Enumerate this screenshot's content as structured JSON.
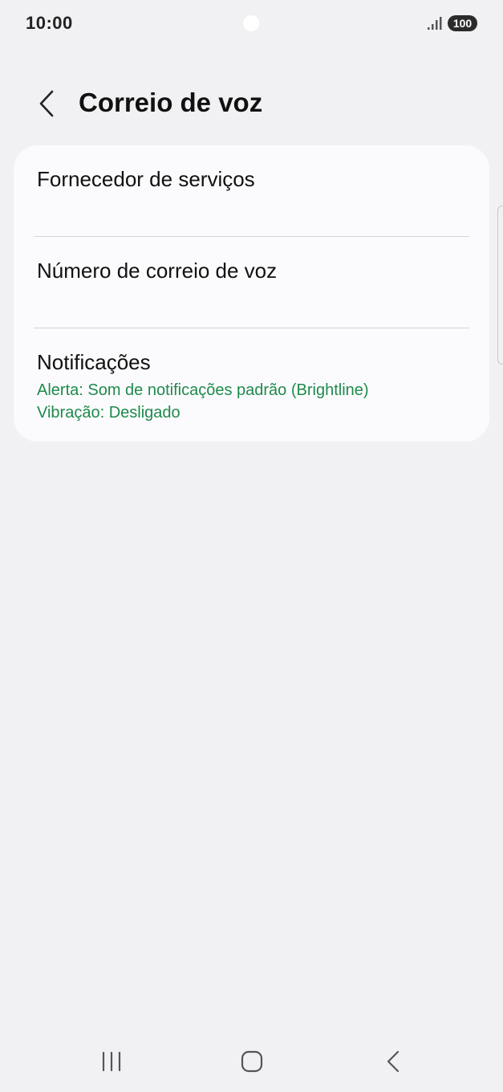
{
  "status_bar": {
    "time": "10:00",
    "battery": "100",
    "icons": [
      "camera-dot",
      "signal-icon",
      "battery-icon"
    ]
  },
  "header": {
    "back_icon": "chevron-left-icon",
    "title": "Correio de voz"
  },
  "settings": {
    "items": [
      {
        "title": "Fornecedor de serviços"
      },
      {
        "title": "Número de correio de voz"
      },
      {
        "title": "Notificações",
        "subtitle_alert": "Alerta: Som de notificações padrão (Brightline)",
        "subtitle_vibration": "Vibração: Desligado"
      }
    ]
  },
  "nav_bar": {
    "icons": [
      "recents-icon",
      "home-icon",
      "back-icon"
    ]
  },
  "colors": {
    "background": "#f1f1f3",
    "card": "#fbfbfd",
    "accent_green": "#1f8a4c",
    "divider": "#d6d6d8"
  }
}
